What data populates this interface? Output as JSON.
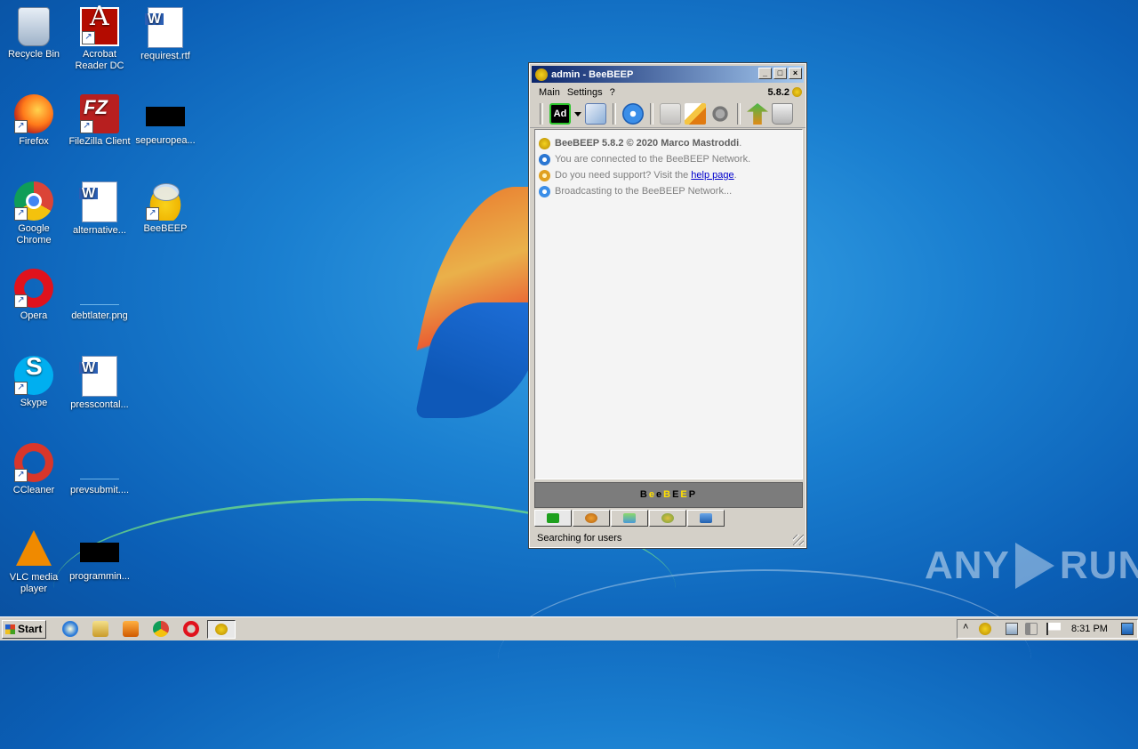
{
  "desktop": {
    "icons": [
      {
        "label": "Recycle Bin",
        "icon": "recycle-bin-icon"
      },
      {
        "label": "Acrobat Reader DC",
        "icon": "acrobat-reader-icon"
      },
      {
        "label": "requirest.rtf",
        "icon": "word-document-icon"
      },
      {
        "label": "Firefox",
        "icon": "firefox-icon"
      },
      {
        "label": "FileZilla Client",
        "icon": "filezilla-icon"
      },
      {
        "label": "sepeuropea...",
        "icon": "black-file-icon"
      },
      {
        "label": "Google Chrome",
        "icon": "chrome-icon"
      },
      {
        "label": "alternative...",
        "icon": "word-document-icon"
      },
      {
        "label": "BeeBEEP",
        "icon": "beebeep-icon"
      },
      {
        "label": "Opera",
        "icon": "opera-icon"
      },
      {
        "label": "debtlater.png",
        "icon": "image-file-icon"
      },
      {
        "label": "Skype",
        "icon": "skype-icon"
      },
      {
        "label": "presscontal...",
        "icon": "word-document-icon"
      },
      {
        "label": "CCleaner",
        "icon": "ccleaner-icon"
      },
      {
        "label": "prevsubmit....",
        "icon": "image-file-icon"
      },
      {
        "label": "VLC media player",
        "icon": "vlc-icon"
      },
      {
        "label": "programmin...",
        "icon": "black-file-icon"
      }
    ]
  },
  "window": {
    "title": "admin - BeeBEEP",
    "menu": [
      "Main",
      "Settings",
      "?"
    ],
    "version": "5.8.2",
    "toolbar_ad": "Ad",
    "messages": [
      {
        "bold": "BeeBEEP 5.8.2 © 2020 Marco Mastroddi",
        "text": "."
      },
      {
        "text": "You are connected to the BeeBEEP Network."
      },
      {
        "text": "Do you need support? Visit the ",
        "link": "help page",
        "after": "."
      },
      {
        "text": "Broadcasting to the BeeBEEP Network..."
      }
    ],
    "brand_letters": [
      "B",
      "e",
      "e",
      "B",
      "E",
      "E",
      "P"
    ],
    "status": "Searching for users"
  },
  "taskbar": {
    "start_label": "Start",
    "clock": "8:31 PM"
  },
  "watermark": {
    "left": "ANY",
    "right": "RUN"
  },
  "colors": {
    "title_start": "#0a246a",
    "title_end": "#a6caf0",
    "brand_bar": "#7c7c7c",
    "brand_accent": "#ffe000"
  }
}
